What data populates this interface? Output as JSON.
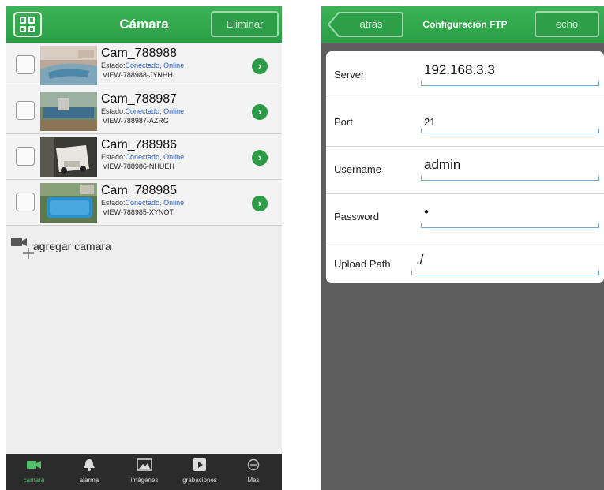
{
  "left_screen": {
    "header": {
      "title": "Cámara",
      "delete_label": "Eliminar",
      "menu_icon": "grid-icon"
    },
    "cameras": [
      {
        "name": "Cam_788988",
        "status_prefix": "Estado:",
        "status": "Conectado, Online",
        "id": "VIEW-788988-JYNHH"
      },
      {
        "name": "Cam_788987",
        "status_prefix": "Estado:",
        "status": "Conectado, Online",
        "id": "VIEW-788987-AZRG"
      },
      {
        "name": "Cam_788986",
        "status_prefix": "Estado:",
        "status": "Conectado, Online",
        "id": "VIEW-788986-NHUEH"
      },
      {
        "name": "Cam_788985",
        "status_prefix": "Estado:",
        "status": "Conectado, Online",
        "id": "VIEW-788985-XYNOT"
      }
    ],
    "add_camera_label": "agregar camara",
    "tabs": [
      {
        "label": "camara",
        "icon": "video-camera-icon",
        "active": true
      },
      {
        "label": "alarma",
        "icon": "bell-icon",
        "active": false
      },
      {
        "label": "imágenes",
        "icon": "image-icon",
        "active": false
      },
      {
        "label": "grabaciones",
        "icon": "recording-icon",
        "active": false
      },
      {
        "label": "Mas",
        "icon": "more-icon",
        "active": false
      }
    ]
  },
  "right_screen": {
    "header": {
      "back_label": "atrás",
      "title": "Configuración FTP",
      "done_label": "echo"
    },
    "fields": [
      {
        "label": "Server",
        "value": "192.168.3.3"
      },
      {
        "label": "Port",
        "value": "21"
      },
      {
        "label": "Username",
        "value": "admin"
      },
      {
        "label": "Password",
        "value": "•"
      },
      {
        "label": "Upload Path",
        "value": "./"
      }
    ]
  },
  "colors": {
    "accent_green": "#2e9f49",
    "status_blue": "#2b62c8",
    "active_tab": "#4fc06a"
  }
}
